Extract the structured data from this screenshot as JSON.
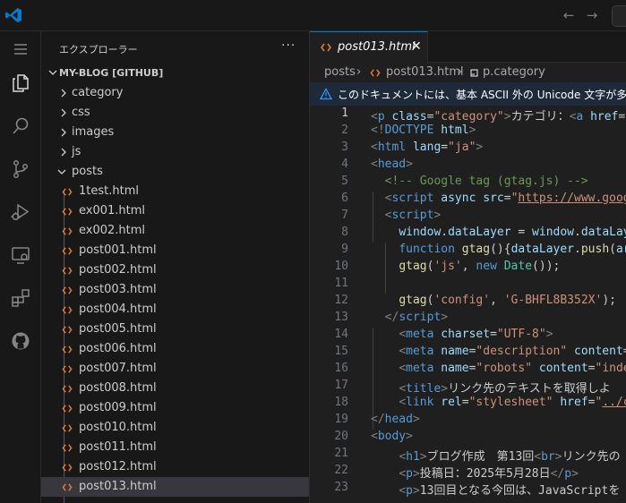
{
  "colors": {
    "accent": "#0078d4",
    "html_icon": "#e37933"
  },
  "titlebar": {
    "logo": "vscode-logo",
    "back_icon": "arrow-left-icon",
    "forward_icon": "arrow-right-icon"
  },
  "activity_bar": [
    "menu-icon",
    "explorer-icon",
    "search-icon",
    "source-control-icon",
    "run-debug-icon",
    "remote-explorer-icon",
    "extensions-icon",
    "github-icon"
  ],
  "sidebar": {
    "title": "エクスプローラー",
    "more": "···",
    "section": "MY-BLOG [GITHUB]",
    "folders": [
      {
        "name": "category",
        "expanded": false
      },
      {
        "name": "css",
        "expanded": false
      },
      {
        "name": "images",
        "expanded": false
      },
      {
        "name": "js",
        "expanded": false
      },
      {
        "name": "posts",
        "expanded": true
      }
    ],
    "files": [
      "1test.html",
      "ex001.html",
      "ex002.html",
      "post001.html",
      "post002.html",
      "post003.html",
      "post004.html",
      "post005.html",
      "post006.html",
      "post007.html",
      "post008.html",
      "post009.html",
      "post010.html",
      "post011.html",
      "post012.html",
      "post013.html"
    ],
    "selected": "post013.html"
  },
  "editor": {
    "tab": {
      "label": "post013.html",
      "close": "✕"
    },
    "breadcrumb": {
      "folder": "posts",
      "file": "post013.html",
      "symbol": "p.category"
    },
    "warning": "このドキュメントには、基本 ASCII 外の Unicode 文字が多数含まれています",
    "current_line": 1,
    "lines": [
      {
        "n": "1",
        "tokens": [
          [
            "br",
            "<"
          ],
          [
            "tag",
            "p"
          ],
          [
            "t",
            " "
          ],
          [
            "attr",
            "class"
          ],
          [
            "t",
            "="
          ],
          [
            "str",
            "\"category\""
          ],
          [
            "br",
            ">"
          ],
          [
            "t",
            "カテゴリ："
          ],
          [
            "br",
            "<"
          ],
          [
            "tag",
            "a"
          ],
          [
            "t",
            " "
          ],
          [
            "attr",
            "href"
          ],
          [
            "t",
            "="
          ]
        ]
      },
      {
        "n": "2",
        "tokens": [
          [
            "br",
            "<!"
          ],
          [
            "tag",
            "DOCTYPE"
          ],
          [
            "t",
            " "
          ],
          [
            "attr",
            "html"
          ],
          [
            "br",
            ">"
          ]
        ]
      },
      {
        "n": "3",
        "tokens": [
          [
            "br",
            "<"
          ],
          [
            "tag",
            "html"
          ],
          [
            "t",
            " "
          ],
          [
            "attr",
            "lang"
          ],
          [
            "t",
            "="
          ],
          [
            "str",
            "\"ja\""
          ],
          [
            "br",
            ">"
          ]
        ]
      },
      {
        "n": "4",
        "tokens": [
          [
            "br",
            "<"
          ],
          [
            "tag",
            "head"
          ],
          [
            "br",
            ">"
          ]
        ]
      },
      {
        "n": "5",
        "tokens": [
          [
            "t",
            "  "
          ],
          [
            "com",
            "<!-- Google tag (gtag.js) -->"
          ]
        ]
      },
      {
        "n": "6",
        "tokens": [
          [
            "t",
            "  "
          ],
          [
            "br",
            "<"
          ],
          [
            "tag",
            "script"
          ],
          [
            "t",
            " "
          ],
          [
            "attr",
            "async"
          ],
          [
            "t",
            " "
          ],
          [
            "attr",
            "src"
          ],
          [
            "t",
            "="
          ],
          [
            "str",
            "\""
          ],
          [
            "url",
            "https://www.goog"
          ]
        ]
      },
      {
        "n": "7",
        "tokens": [
          [
            "t",
            "  "
          ],
          [
            "br",
            "<"
          ],
          [
            "tag",
            "script"
          ],
          [
            "br",
            ">"
          ]
        ]
      },
      {
        "n": "8",
        "tokens": [
          [
            "t",
            "    "
          ],
          [
            "var",
            "window"
          ],
          [
            "t",
            "."
          ],
          [
            "var",
            "dataLayer"
          ],
          [
            "t",
            " = "
          ],
          [
            "var",
            "window"
          ],
          [
            "t",
            "."
          ],
          [
            "var",
            "dataLay"
          ]
        ]
      },
      {
        "n": "9",
        "tokens": [
          [
            "t",
            "    "
          ],
          [
            "kw",
            "function"
          ],
          [
            "t",
            " "
          ],
          [
            "fn",
            "gtag"
          ],
          [
            "t",
            "(){"
          ],
          [
            "var",
            "dataLayer"
          ],
          [
            "t",
            "."
          ],
          [
            "fn",
            "push"
          ],
          [
            "t",
            "("
          ],
          [
            "var",
            "ar"
          ]
        ]
      },
      {
        "n": "10",
        "tokens": [
          [
            "t",
            "    "
          ],
          [
            "fn",
            "gtag"
          ],
          [
            "t",
            "("
          ],
          [
            "str",
            "'js'"
          ],
          [
            "t",
            ", "
          ],
          [
            "kw",
            "new"
          ],
          [
            "t",
            " "
          ],
          [
            "cls",
            "Date"
          ],
          [
            "t",
            "());"
          ]
        ]
      },
      {
        "n": "11",
        "tokens": []
      },
      {
        "n": "12",
        "tokens": [
          [
            "t",
            "    "
          ],
          [
            "fn",
            "gtag"
          ],
          [
            "t",
            "("
          ],
          [
            "str",
            "'config'"
          ],
          [
            "t",
            ", "
          ],
          [
            "str",
            "'G-BHFL8B352X'"
          ],
          [
            "t",
            ");"
          ]
        ]
      },
      {
        "n": "13",
        "tokens": [
          [
            "t",
            "  "
          ],
          [
            "br",
            "</"
          ],
          [
            "tag",
            "script"
          ],
          [
            "br",
            ">"
          ]
        ]
      },
      {
        "n": "14",
        "tokens": [
          [
            "t",
            "    "
          ],
          [
            "br",
            "<"
          ],
          [
            "tag",
            "meta"
          ],
          [
            "t",
            " "
          ],
          [
            "attr",
            "charset"
          ],
          [
            "t",
            "="
          ],
          [
            "str",
            "\"UTF-8\""
          ],
          [
            "br",
            ">"
          ]
        ]
      },
      {
        "n": "15",
        "tokens": [
          [
            "t",
            "    "
          ],
          [
            "br",
            "<"
          ],
          [
            "tag",
            "meta"
          ],
          [
            "t",
            " "
          ],
          [
            "attr",
            "name"
          ],
          [
            "t",
            "="
          ],
          [
            "str",
            "\"description\""
          ],
          [
            "t",
            " "
          ],
          [
            "attr",
            "content"
          ],
          [
            "t",
            "="
          ]
        ]
      },
      {
        "n": "16",
        "tokens": [
          [
            "t",
            "    "
          ],
          [
            "br",
            "<"
          ],
          [
            "tag",
            "meta"
          ],
          [
            "t",
            " "
          ],
          [
            "attr",
            "name"
          ],
          [
            "t",
            "="
          ],
          [
            "str",
            "\"robots\""
          ],
          [
            "t",
            " "
          ],
          [
            "attr",
            "content"
          ],
          [
            "t",
            "="
          ],
          [
            "str",
            "\"inde"
          ]
        ]
      },
      {
        "n": "17",
        "tokens": [
          [
            "t",
            "    "
          ],
          [
            "br",
            "<"
          ],
          [
            "tag",
            "title"
          ],
          [
            "br",
            ">"
          ],
          [
            "t",
            "リンク先のテキストを取得しよ"
          ]
        ]
      },
      {
        "n": "18",
        "tokens": [
          [
            "t",
            "    "
          ],
          [
            "br",
            "<"
          ],
          [
            "tag",
            "link"
          ],
          [
            "t",
            " "
          ],
          [
            "attr",
            "rel"
          ],
          [
            "t",
            "="
          ],
          [
            "str",
            "\"stylesheet\""
          ],
          [
            "t",
            " "
          ],
          [
            "attr",
            "href"
          ],
          [
            "t",
            "="
          ],
          [
            "str",
            "\""
          ],
          [
            "url",
            "../c"
          ]
        ]
      },
      {
        "n": "19",
        "tokens": [
          [
            "br",
            "</"
          ],
          [
            "tag",
            "head"
          ],
          [
            "br",
            ">"
          ]
        ]
      },
      {
        "n": "20",
        "tokens": [
          [
            "br",
            "<"
          ],
          [
            "tag",
            "body"
          ],
          [
            "br",
            ">"
          ]
        ]
      },
      {
        "n": "21",
        "tokens": [
          [
            "t",
            "    "
          ],
          [
            "br",
            "<"
          ],
          [
            "tag",
            "h1"
          ],
          [
            "br",
            ">"
          ],
          [
            "t",
            "ブログ作成　第13回"
          ],
          [
            "br",
            "<"
          ],
          [
            "tag",
            "br"
          ],
          [
            "br",
            ">"
          ],
          [
            "t",
            "リンク先の"
          ]
        ]
      },
      {
        "n": "22",
        "tokens": [
          [
            "t",
            "    "
          ],
          [
            "br",
            "<"
          ],
          [
            "tag",
            "p"
          ],
          [
            "br",
            ">"
          ],
          [
            "t",
            "投稿日：2025年5月28日"
          ],
          [
            "br",
            "</"
          ],
          [
            "tag",
            "p"
          ],
          [
            "br",
            ">"
          ]
        ]
      },
      {
        "n": "23",
        "tokens": [
          [
            "t",
            "    "
          ],
          [
            "br",
            "<"
          ],
          [
            "tag",
            "p"
          ],
          [
            "br",
            ">"
          ],
          [
            "t",
            "13回目となる今回は、JavaScriptを"
          ]
        ]
      }
    ]
  }
}
